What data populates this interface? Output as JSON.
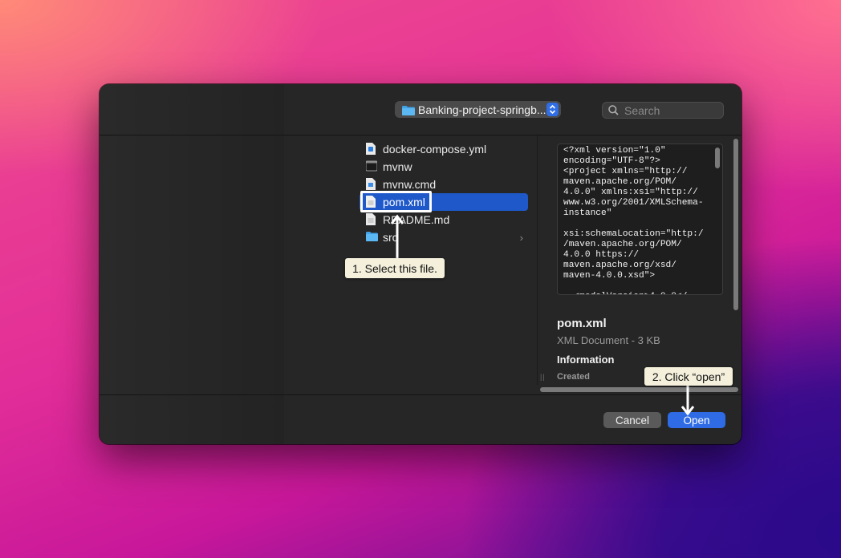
{
  "toolbar": {
    "path_label": "Banking-project-springb...",
    "search_placeholder": "Search"
  },
  "files": [
    {
      "name": "docker-compose.yml",
      "icon": "docker-file-icon",
      "selected": false
    },
    {
      "name": "mvnw",
      "icon": "executable-file-icon",
      "selected": false
    },
    {
      "name": "mvnw.cmd",
      "icon": "cmd-file-icon",
      "selected": false
    },
    {
      "name": "pom.xml",
      "icon": "document-icon",
      "selected": true
    },
    {
      "name": "README.md",
      "icon": "document-icon",
      "selected": false
    },
    {
      "name": "src",
      "icon": "folder-icon",
      "selected": false
    }
  ],
  "preview": {
    "text": "<?xml version=\"1.0\"\nencoding=\"UTF-8\"?>\n<project xmlns=\"http://\nmaven.apache.org/POM/\n4.0.0\" xmlns:xsi=\"http://\nwww.w3.org/2001/XMLSchema-\ninstance\"\n\nxsi:schemaLocation=\"http:/\n/maven.apache.org/POM/\n4.0.0 https://\nmaven.apache.org/xsd/\nmaven-4.0.0.xsd\">\n\n  <modelVersion>4.0.0</",
    "file_name": "pom.xml",
    "file_kind": "XML Document - 3 KB",
    "info_heading": "Information",
    "created_label": "Created"
  },
  "buttons": {
    "cancel": "Cancel",
    "open": "Open"
  },
  "annotations": {
    "step1": "1. Select this file.",
    "step2": "2. Click “open”"
  },
  "colors": {
    "accent": "#2e6be5",
    "selection": "#1e58c9",
    "callout_bg": "#f4f0dc"
  }
}
